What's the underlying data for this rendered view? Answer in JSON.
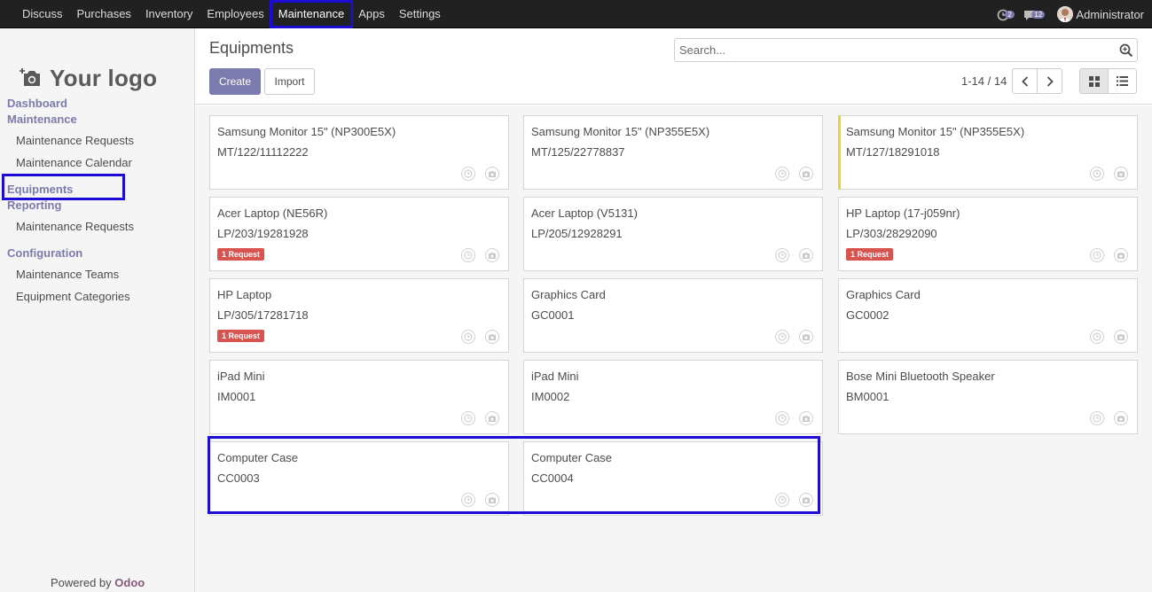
{
  "topbar": {
    "menu": [
      "Discuss",
      "Purchases",
      "Inventory",
      "Employees",
      "Maintenance",
      "Apps",
      "Settings"
    ],
    "active_menu": "Maintenance",
    "activity_count": "2",
    "message_count": "12",
    "user_name": "Administrator"
  },
  "sidebar": {
    "logo_text": "Your logo",
    "sections": {
      "dashboard": "Dashboard",
      "maintenance": "Maintenance",
      "maintenance_requests": "Maintenance Requests",
      "maintenance_calendar": "Maintenance Calendar",
      "equipments": "Equipments",
      "reporting": "Reporting",
      "reporting_requests": "Maintenance Requests",
      "configuration": "Configuration",
      "maintenance_teams": "Maintenance Teams",
      "equipment_categories": "Equipment Categories"
    },
    "powered_by": "Powered by",
    "powered_brand": "Odoo"
  },
  "control_panel": {
    "title": "Equipments",
    "create_label": "Create",
    "import_label": "Import",
    "search_placeholder": "Search...",
    "pager": "1-14 / 14"
  },
  "cards": [
    {
      "name": "Samsung Monitor 15\" (NP300E5X)",
      "ref": "MT/122/11112222",
      "badge": ""
    },
    {
      "name": "Samsung Monitor 15\" (NP355E5X)",
      "ref": "MT/125/22778837",
      "badge": ""
    },
    {
      "name": "Samsung Monitor 15\" (NP355E5X)",
      "ref": "MT/127/18291018",
      "badge": ""
    },
    {
      "name": "Acer Laptop (NE56R)",
      "ref": "LP/203/19281928",
      "badge": "1 Request"
    },
    {
      "name": "Acer Laptop (V5131)",
      "ref": "LP/205/12928291",
      "badge": ""
    },
    {
      "name": "HP Laptop (17-j059nr)",
      "ref": "LP/303/28292090",
      "badge": "1 Request"
    },
    {
      "name": "HP Laptop",
      "ref": "LP/305/17281718",
      "badge": "1 Request"
    },
    {
      "name": "Graphics Card",
      "ref": "GC0001",
      "badge": ""
    },
    {
      "name": "Graphics Card",
      "ref": "GC0002",
      "badge": ""
    },
    {
      "name": "iPad Mini",
      "ref": "IM0001",
      "badge": ""
    },
    {
      "name": "iPad Mini",
      "ref": "IM0002",
      "badge": ""
    },
    {
      "name": "Bose Mini Bluetooth Speaker",
      "ref": "BM0001",
      "badge": ""
    },
    {
      "name": "Computer Case",
      "ref": "CC0003",
      "badge": ""
    },
    {
      "name": "Computer Case",
      "ref": "CC0004",
      "badge": ""
    }
  ],
  "colors": {
    "primary": "#7c7bad",
    "highlight": "#1d0bd6",
    "badge": "#d9534f",
    "yellow_status": "#f0d130"
  }
}
